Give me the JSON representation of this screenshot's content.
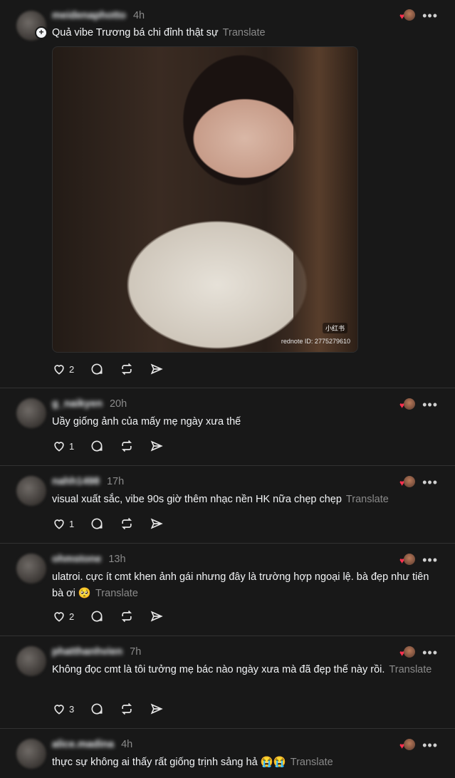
{
  "posts": [
    {
      "time": "4h",
      "username": "meidenaphotto",
      "text": "Quả vibe Trương bá chi đỉnh thật sự",
      "translate": "Translate",
      "likes": "2",
      "image": {
        "watermark_top": "小红书",
        "watermark_bottom": "rednote ID: 2775279610"
      }
    },
    {
      "time": "20h",
      "username": "g_naikyen",
      "text": "Uầy giống ảnh của mấy mẹ ngày xưa thế",
      "translate": "",
      "likes": "1"
    },
    {
      "time": "17h",
      "username": "nahh1498",
      "text": "visual xuất sắc, vibe 90s giờ thêm nhạc nền HK nữa chẹp chẹp",
      "translate": "Translate",
      "likes": "1"
    },
    {
      "time": "13h",
      "username": "ohmstone",
      "text": "ulatroi. cực ít cmt khen ảnh gái nhưng đây là trường hợp ngoại lệ. bà đẹp như tiên bà ơi 🥺",
      "translate": "Translate",
      "likes": "2"
    },
    {
      "time": "7h",
      "username": "phatthanhvien",
      "text": "Không đọc cmt là tôi tưởng mẹ bác nào ngày xưa mà đã đẹp thế này rồi.",
      "translate": "Translate",
      "likes": "3"
    },
    {
      "time": "4h",
      "username": "alice.madina",
      "text": "thực sự không ai thấy rất giống trịnh sảng hả 😭😭",
      "translate": "Translate",
      "likes": ""
    }
  ],
  "icons": {
    "like": "heart-icon",
    "reply": "comment-icon",
    "repost": "repost-icon",
    "share": "send-icon",
    "more": "more-icon"
  },
  "colors": {
    "background": "#181818",
    "text": "#f3f5f7",
    "muted": "#8a8a8a",
    "divider": "#323232",
    "heart": "#ff304f"
  }
}
